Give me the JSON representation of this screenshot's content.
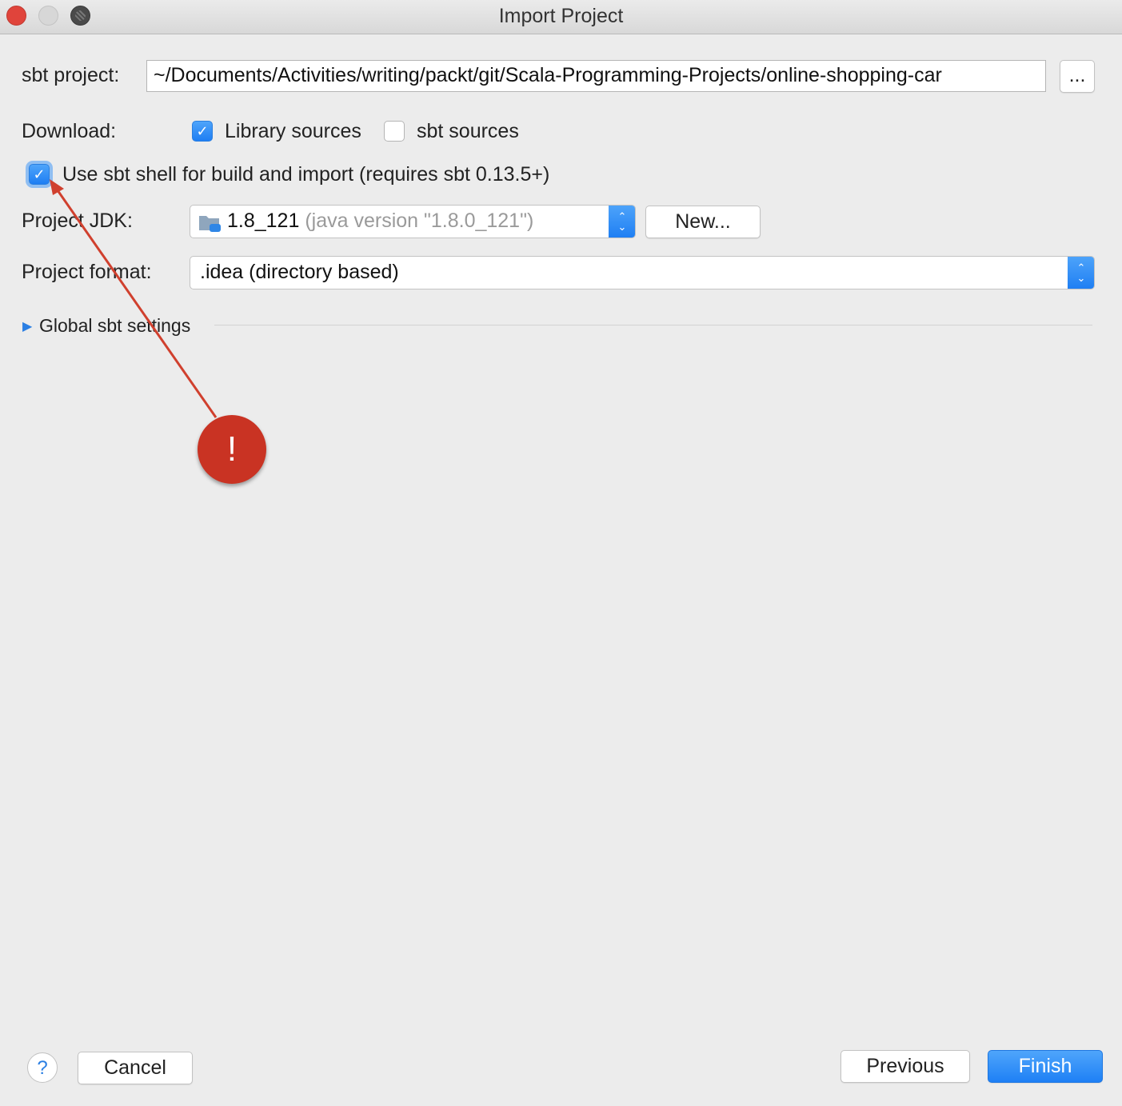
{
  "window": {
    "title": "Import Project"
  },
  "sbt_project": {
    "label": "sbt project:",
    "value": "~/Documents/Activities/writing/packt/git/Scala-Programming-Projects/online-shopping-car",
    "browse_label": "..."
  },
  "download": {
    "label": "Download:",
    "library_sources": {
      "label": "Library sources",
      "checked": true
    },
    "sbt_sources": {
      "label": "sbt sources",
      "checked": false
    }
  },
  "sbt_shell": {
    "label": "Use sbt shell for build and import (requires sbt 0.13.5+)",
    "checked": true
  },
  "jdk": {
    "label": "Project JDK:",
    "selected": "1.8_121",
    "detail": "(java version \"1.8.0_121\")",
    "new_label": "New..."
  },
  "format": {
    "label": "Project format:",
    "selected": ".idea (directory based)"
  },
  "global_settings": {
    "label": "Global sbt settings"
  },
  "annotation": {
    "text": "!",
    "color": "#c93323"
  },
  "footer": {
    "help_label": "?",
    "cancel_label": "Cancel",
    "previous_label": "Previous",
    "finish_label": "Finish"
  },
  "colors": {
    "accent": "#1e80f5",
    "background": "#ececec"
  }
}
